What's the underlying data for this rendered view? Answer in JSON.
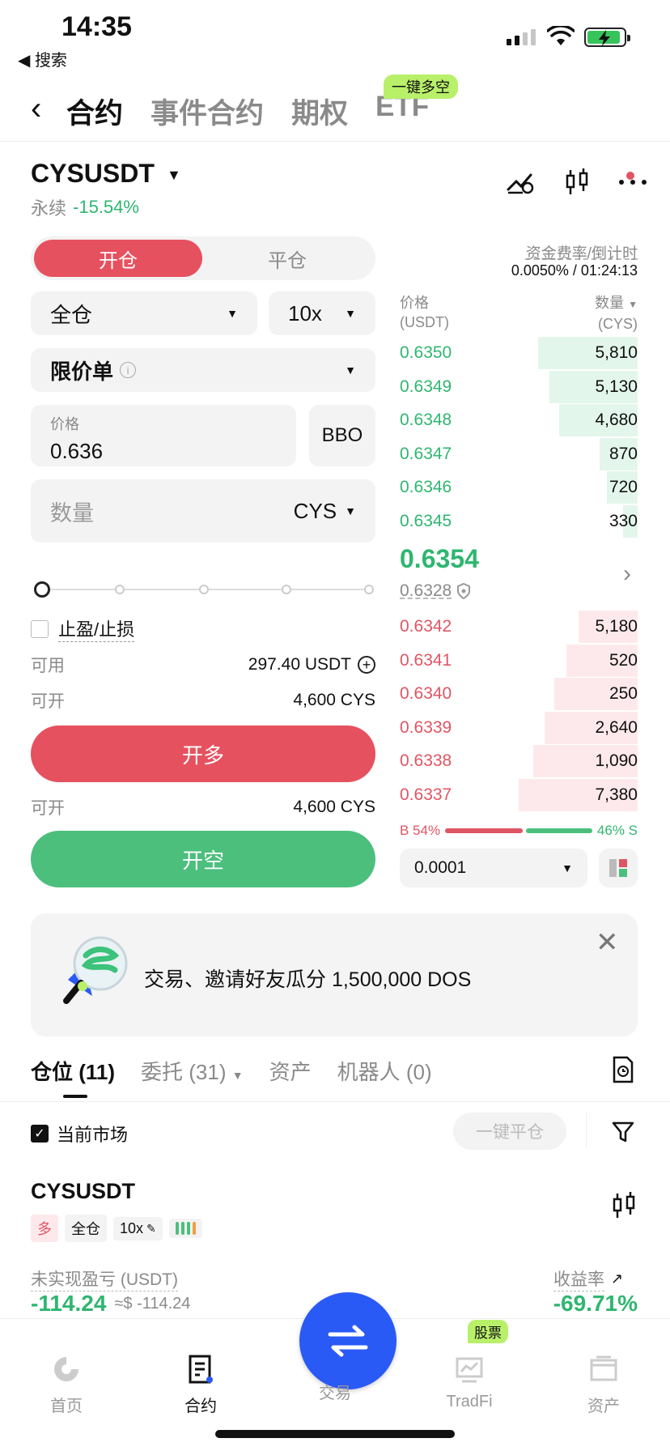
{
  "status_bar": {
    "time": "14:35",
    "back_label": "◀ 搜索"
  },
  "nav": {
    "tabs": [
      {
        "label": "合约",
        "active": true
      },
      {
        "label": "事件合约",
        "active": false
      },
      {
        "label": "期权",
        "active": false
      },
      {
        "label": "ETF",
        "active": false
      }
    ],
    "etf_badge": "一键多空"
  },
  "symbol": {
    "name": "CYSUSDT",
    "type": "永续",
    "change": "-15.54%"
  },
  "order_form": {
    "toggle": {
      "open": "开仓",
      "close": "平仓"
    },
    "margin_mode": "全仓",
    "leverage": "10x",
    "order_type": "限价单",
    "price_label": "价格",
    "price_value": "0.636",
    "bbo_label": "BBO",
    "qty_placeholder": "数量",
    "qty_unit": "CYS",
    "slider_percent": 0,
    "tpsl_label": "止盈/止损",
    "available_label": "可用",
    "available_value": "297.40 USDT",
    "can_open_label": "可开",
    "can_open_long": "4,600 CYS",
    "long_button": "开多",
    "can_open_short": "4,600 CYS",
    "short_button": "开空"
  },
  "order_book": {
    "funding_label": "资金费率/倒计时",
    "funding_value": "0.0050% / 01:24:13",
    "price_header": "价格",
    "price_unit": "(USDT)",
    "qty_header": "数量",
    "qty_unit": "(CYS)",
    "asks": [
      {
        "price": "0.6350",
        "qty": "5,810",
        "depth": 0.42
      },
      {
        "price": "0.6349",
        "qty": "5,130",
        "depth": 0.37
      },
      {
        "price": "0.6348",
        "qty": "4,680",
        "depth": 0.33
      },
      {
        "price": "0.6347",
        "qty": "870",
        "depth": 0.16
      },
      {
        "price": "0.6346",
        "qty": "720",
        "depth": 0.13
      },
      {
        "price": "0.6345",
        "qty": "330",
        "depth": 0.06
      }
    ],
    "last_price": "0.6354",
    "mark_price": "0.6328",
    "bids": [
      {
        "price": "0.6342",
        "qty": "5,180",
        "depth": 0.25
      },
      {
        "price": "0.6341",
        "qty": "520",
        "depth": 0.3
      },
      {
        "price": "0.6340",
        "qty": "250",
        "depth": 0.35
      },
      {
        "price": "0.6339",
        "qty": "2,640",
        "depth": 0.39
      },
      {
        "price": "0.6338",
        "qty": "1,090",
        "depth": 0.44
      },
      {
        "price": "0.6337",
        "qty": "7,380",
        "depth": 0.5
      }
    ],
    "buy_ratio_label": "B 54%",
    "sell_ratio_label": "46% S",
    "buy_ratio": 0.54,
    "precision": "0.0001"
  },
  "banner": {
    "text": "交易、邀请好友瓜分 1,500,000 DOS"
  },
  "positions": {
    "tabs": [
      {
        "label": "仓位 (11)",
        "active": true
      },
      {
        "label": "委托 (31)",
        "active": false
      },
      {
        "label": "资产",
        "active": false
      },
      {
        "label": "机器人 (0)",
        "active": false
      }
    ],
    "current_market_label": "当前市场",
    "close_all_label": "一键平仓",
    "card": {
      "symbol": "CYSUSDT",
      "side": "多",
      "margin": "全仓",
      "leverage": "10x",
      "pnl_label": "未实现盈亏 (USDT)",
      "pnl_value": "-114.24",
      "pnl_usd": "≈$ -114.24",
      "roe_label": "收益率",
      "roe_value": "-69.71%"
    }
  },
  "bottom_nav": [
    {
      "label": "首页"
    },
    {
      "label": "合约"
    },
    {
      "label": "交易"
    },
    {
      "label": "TradFi",
      "badge": "股票"
    },
    {
      "label": "资产"
    }
  ],
  "colors": {
    "red": "#e6515f",
    "green": "#4cbf7d",
    "blue": "#2a5af5",
    "badge": "#b8f06a"
  }
}
